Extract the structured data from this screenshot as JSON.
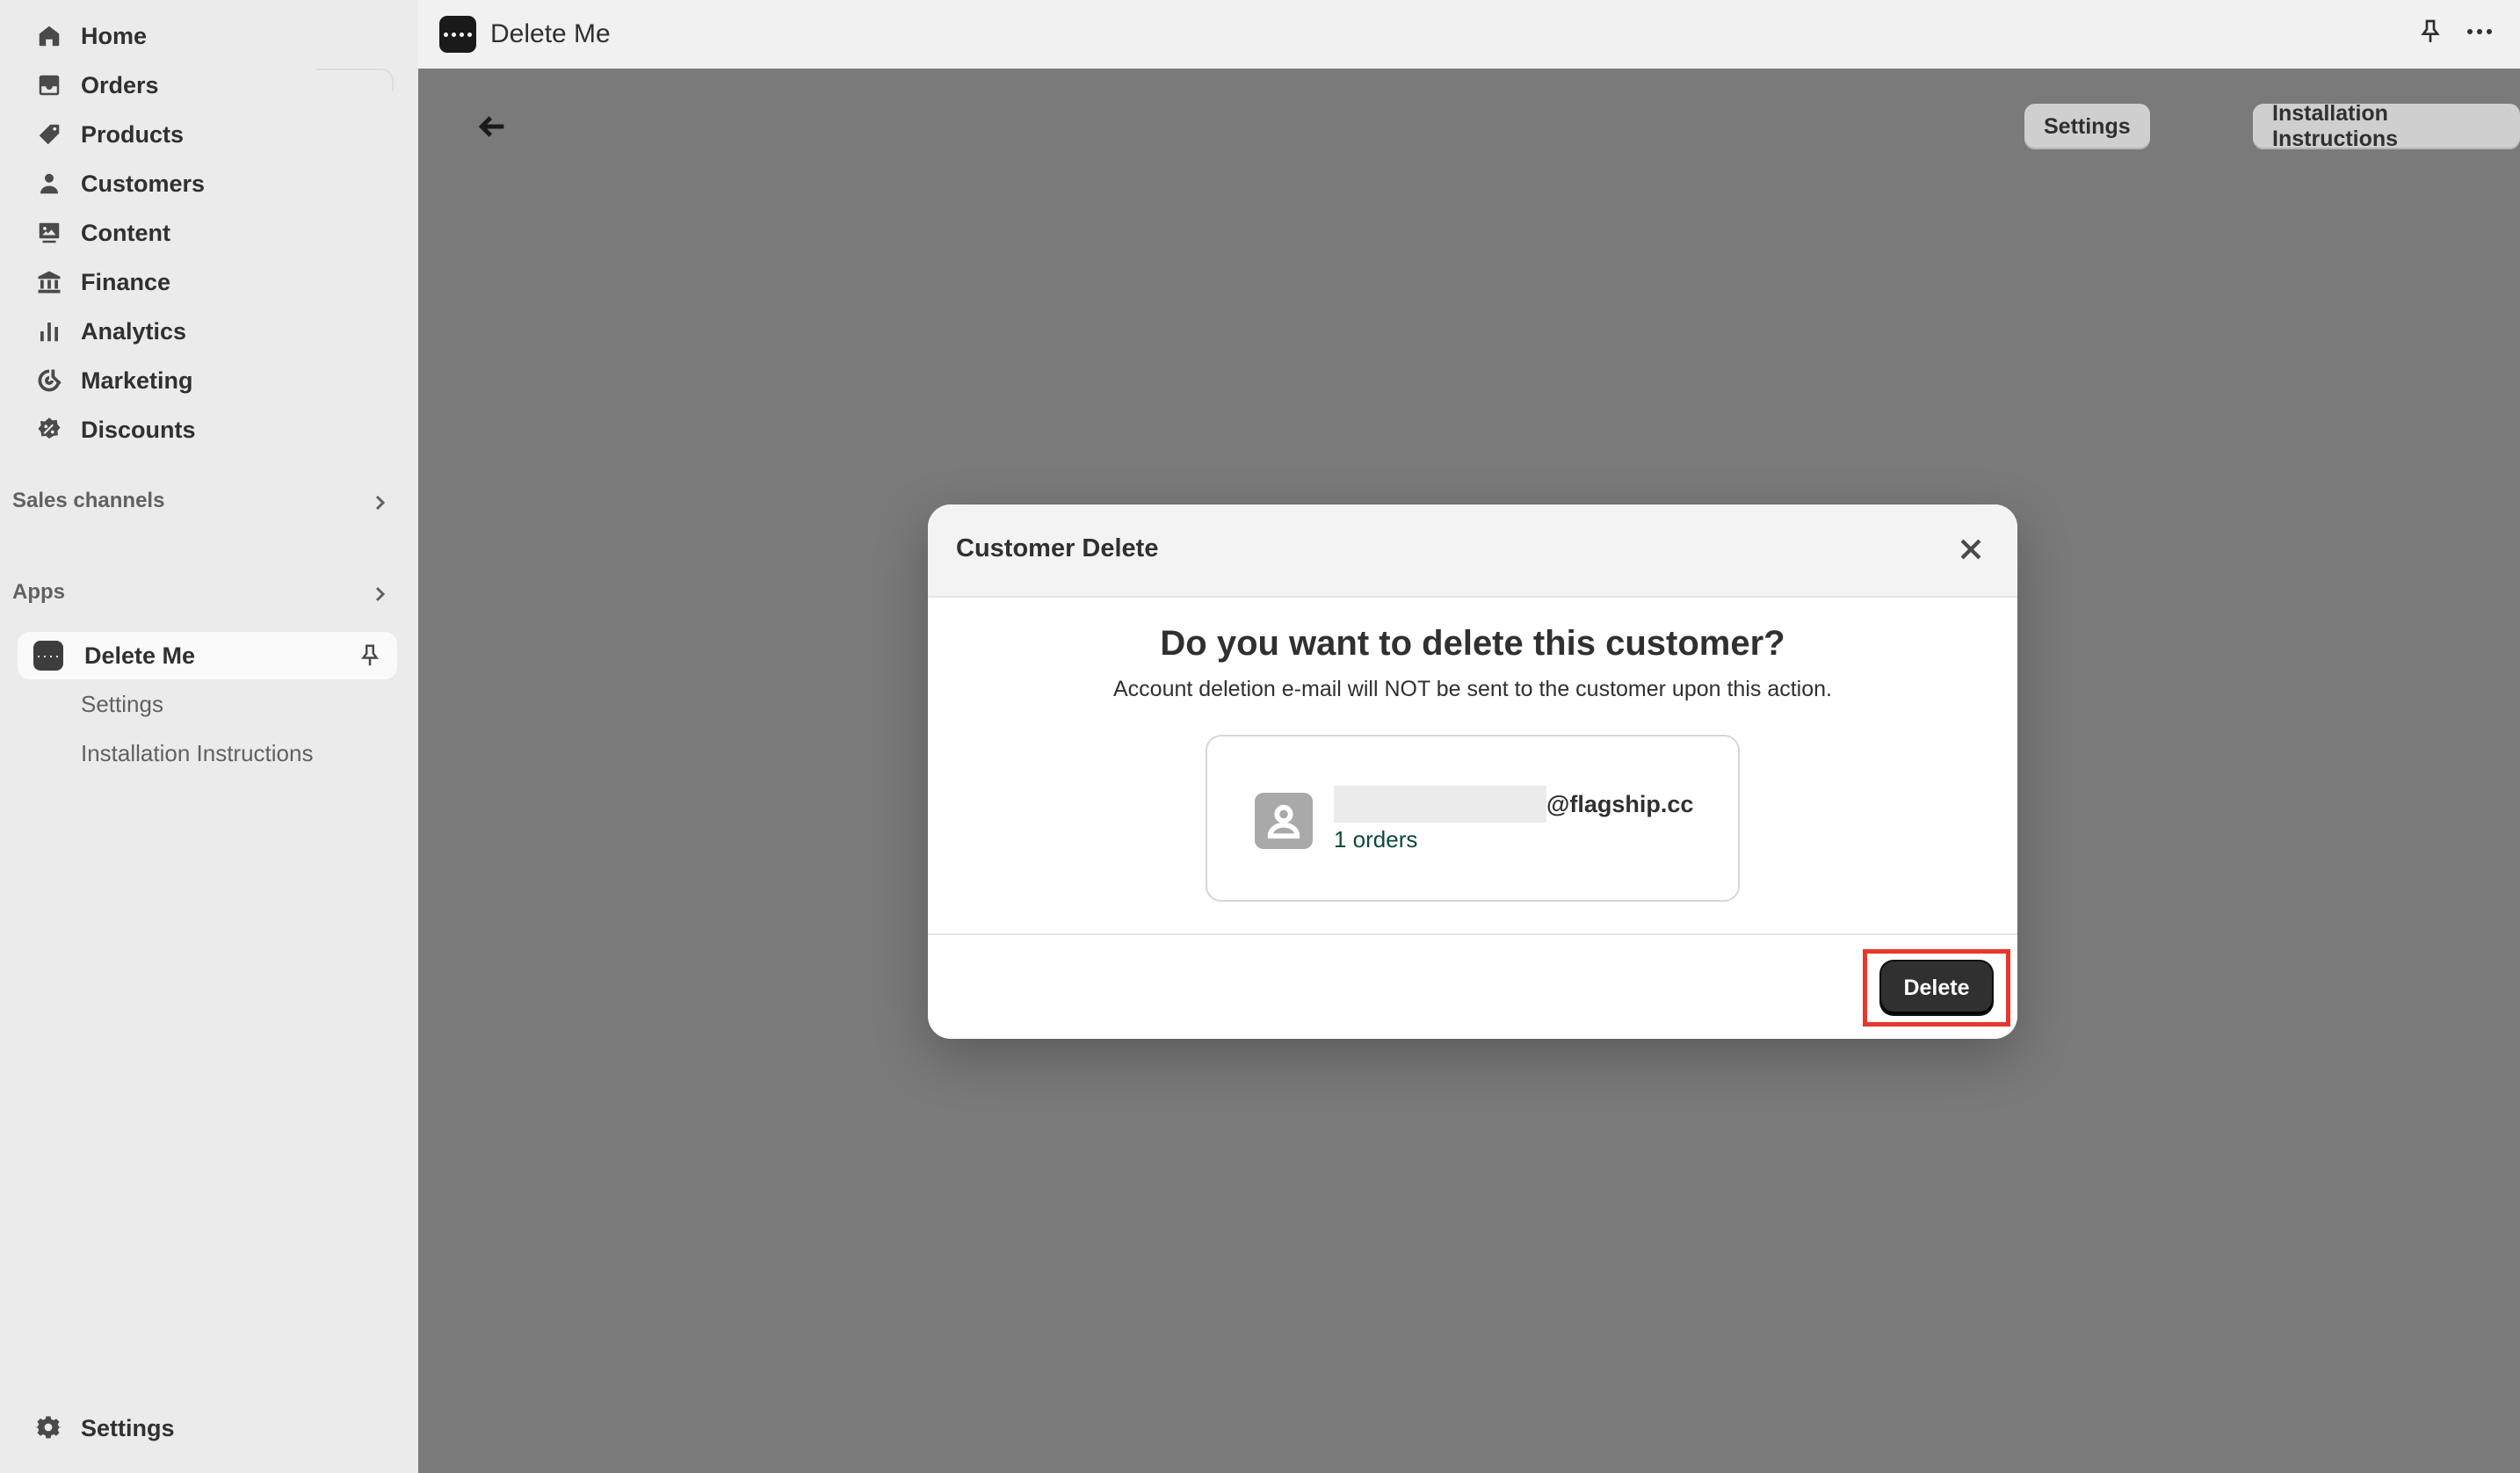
{
  "sidebar": {
    "items": [
      {
        "label": "Home",
        "icon": "home-icon"
      },
      {
        "label": "Orders",
        "icon": "orders-icon"
      },
      {
        "label": "Products",
        "icon": "tag-icon"
      },
      {
        "label": "Customers",
        "icon": "person-icon"
      },
      {
        "label": "Content",
        "icon": "image-icon"
      },
      {
        "label": "Finance",
        "icon": "bank-icon"
      },
      {
        "label": "Analytics",
        "icon": "bar-chart-icon"
      },
      {
        "label": "Marketing",
        "icon": "target-icon"
      },
      {
        "label": "Discounts",
        "icon": "discount-icon"
      }
    ],
    "sales_channels": "Sales channels",
    "apps": "Apps",
    "active_app": "Delete Me",
    "sub_items": [
      "Settings",
      "Installation Instructions"
    ],
    "bottom_settings": "Settings"
  },
  "topbar": {
    "title": "Delete Me"
  },
  "main": {
    "settings_button": "Settings",
    "instructions_button": "Installation Instructions"
  },
  "modal": {
    "title": "Customer Delete",
    "question": "Do you want to delete this customer?",
    "subtext": "Account deletion e-mail will NOT be sent to the customer upon this action.",
    "email_domain": "@flagship.cc",
    "orders": "1 orders",
    "delete_button": "Delete"
  },
  "colors": {
    "highlight": "#e8372a",
    "primary_button": "#303030",
    "overlay": "#7a7a7a"
  }
}
